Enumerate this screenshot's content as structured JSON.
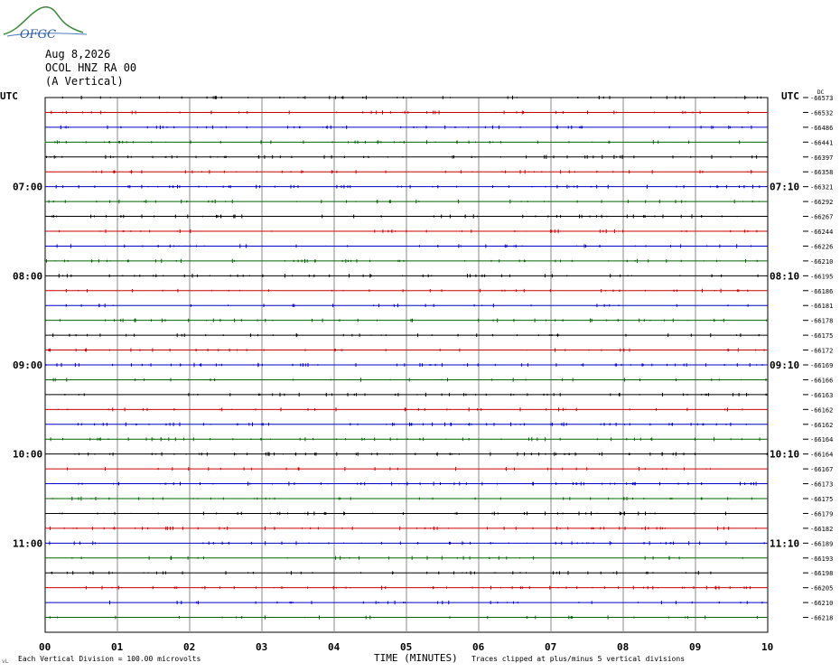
{
  "logo_text": "OFGC",
  "header": {
    "date": "Aug 8,2026",
    "station": "OCOL HNZ RA 00",
    "component": "(A Vertical)"
  },
  "left_axis_title": "UTC",
  "right_axis_title": "UTC",
  "dc_label": "DC",
  "left_hour_labels": [
    "07:00",
    "08:00",
    "09:00",
    "10:00",
    "11:00"
  ],
  "right_hour_labels": [
    "07:10",
    "08:10",
    "09:10",
    "10:10",
    "11:10"
  ],
  "footer": {
    "scale_note": "Each Vertical Division = 100.00 microvolts",
    "clip_note": "Traces clipped at plus/minus 5 vertical divisions",
    "corner_mark": "vL"
  },
  "chart_data": {
    "type": "line",
    "title": "",
    "xlabel": "TIME (MINUTES)",
    "ylabel": "UTC",
    "x_ticks": [
      "00",
      "01",
      "02",
      "03",
      "04",
      "05",
      "06",
      "07",
      "08",
      "09",
      "10"
    ],
    "xlim": [
      0,
      10
    ],
    "grid": true,
    "trace_colors": [
      "#000000",
      "#cc0000",
      "#0000cc",
      "#006600"
    ],
    "dc_offsets": [
      -66573,
      -66532,
      -66486,
      -66441,
      -66397,
      -66358,
      -66321,
      -66292,
      -66267,
      -66244,
      -66226,
      -66210,
      -66195,
      -66186,
      -66181,
      -66178,
      -66175,
      -66172,
      -66169,
      -66166,
      -66163,
      -66162,
      -66162,
      -66164,
      -66164,
      -66167,
      -66173,
      -66175,
      -66179,
      -66182,
      -66189,
      -66193,
      -66198,
      -66205,
      -66210,
      -66218
    ]
  }
}
